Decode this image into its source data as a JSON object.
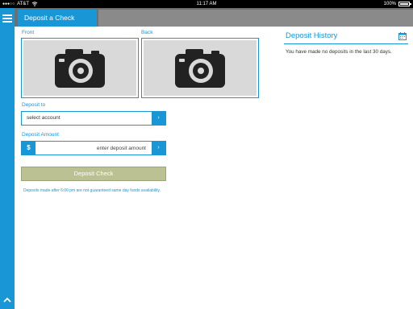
{
  "statusbar": {
    "carrier": "AT&T",
    "time": "11:17 AM",
    "battery": "100%",
    "battery_level": 1.0
  },
  "icons": {
    "menu": "hamburger-menu-icon",
    "scroll_up": "chevron-up-icon",
    "camera": "camera-icon",
    "calendar": "calendar-icon",
    "chevron": "chevron-right-icon"
  },
  "header": {
    "tab_title": "Deposit a Check"
  },
  "check": {
    "front_label": "Front",
    "back_label": "Back"
  },
  "deposit_to": {
    "label": "Deposit to",
    "selected": "select account"
  },
  "amount": {
    "label": "Deposit Amount",
    "currency_symbol": "$",
    "placeholder": "enter deposit amount"
  },
  "action": {
    "button_label": "Deposit Check",
    "notice": "Deposits made after 6:00 pm are not guaranteed same day funds availability."
  },
  "history": {
    "title": "Deposit History",
    "empty_message": "You have made no deposits in the last 30 days."
  },
  "colors": {
    "accent": "#1996d6",
    "topbar": "#6f6f6f",
    "button_disabled": "#bcc193",
    "photo_bg": "#d9d9d9"
  }
}
